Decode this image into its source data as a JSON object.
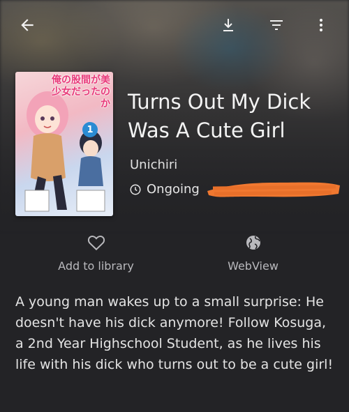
{
  "toolbar": {
    "back_icon": "arrow-left-icon",
    "download_icon": "download-icon",
    "filter_icon": "filter-icon",
    "more_icon": "more-vert-icon"
  },
  "manga": {
    "title": "Turns Out My Dick Was A Cute Girl",
    "author": "Unichiri",
    "status": "Ongoing",
    "cover": {
      "title_text": "俺の股間が美少女だったのか",
      "volume": "1"
    }
  },
  "actions": {
    "library_label": "Add to library",
    "webview_label": "WebView"
  },
  "description": "A young man wakes up to a small surprise: He doesn't have his dick anymore! Follow Kosuga, a 2nd Year Highschool Student, as he lives his life with his dick who turns out to be a cute girl!",
  "colors": {
    "background": "#232326",
    "scribble": "#f07830"
  }
}
